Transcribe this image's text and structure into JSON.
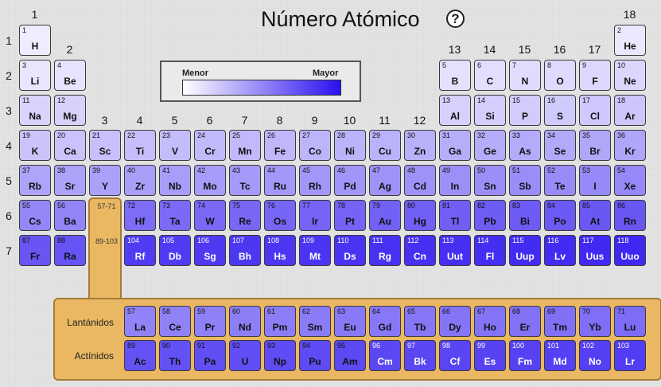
{
  "title": "Número Atómico",
  "help_label": "?",
  "legend": {
    "low_label": "Menor",
    "high_label": "Mayor",
    "colors": [
      "#ffffff",
      "#2a10f0"
    ]
  },
  "groups": [
    "1",
    "2",
    "3",
    "4",
    "5",
    "6",
    "7",
    "8",
    "9",
    "10",
    "11",
    "12",
    "13",
    "14",
    "15",
    "16",
    "17",
    "18"
  ],
  "periods": [
    "1",
    "2",
    "3",
    "4",
    "5",
    "6",
    "7"
  ],
  "lanthanide_range": "57-71",
  "actinide_range": "89-103",
  "lanthanides_label": "Lantánidos",
  "actinides_label": "Actínidos",
  "periodic_rows": [
    [
      "1:H",
      "",
      "",
      "",
      "",
      "",
      "",
      "",
      "",
      "",
      "",
      "",
      "",
      "",
      "",
      "",
      "",
      "2:He"
    ],
    [
      "3:Li",
      "4:Be",
      "",
      "",
      "",
      "",
      "",
      "",
      "",
      "",
      "",
      "",
      "5:B",
      "6:C",
      "7:N",
      "8:O",
      "9:F",
      "10:Ne"
    ],
    [
      "11:Na",
      "12:Mg",
      "",
      "",
      "",
      "",
      "",
      "",
      "",
      "",
      "",
      "",
      "13:Al",
      "14:Si",
      "15:P",
      "16:S",
      "17:Cl",
      "18:Ar"
    ],
    [
      "19:K",
      "20:Ca",
      "21:Sc",
      "22:Ti",
      "23:V",
      "24:Cr",
      "25:Mn",
      "26:Fe",
      "27:Co",
      "28:Ni",
      "29:Cu",
      "30:Zn",
      "31:Ga",
      "32:Ge",
      "33:As",
      "34:Se",
      "35:Br",
      "36:Kr"
    ],
    [
      "37:Rb",
      "38:Sr",
      "39:Y",
      "40:Zr",
      "41:Nb",
      "42:Mo",
      "43:Tc",
      "44:Ru",
      "45:Rh",
      "46:Pd",
      "47:Ag",
      "48:Cd",
      "49:In",
      "50:Sn",
      "51:Sb",
      "52:Te",
      "53:I",
      "54:Xe"
    ],
    [
      "55:Cs",
      "56:Ba",
      "",
      "72:Hf",
      "73:Ta",
      "74:W",
      "75:Re",
      "76:Os",
      "77:Ir",
      "78:Pt",
      "79:Au",
      "80:Hg",
      "81:Tl",
      "82:Pb",
      "83:Bi",
      "84:Po",
      "85:At",
      "86:Rn"
    ],
    [
      "87:Fr",
      "88:Ra",
      "",
      "104:Rf",
      "105:Db",
      "106:Sg",
      "107:Bh",
      "108:Hs",
      "109:Mt",
      "110:Ds",
      "111:Rg",
      "112:Cn",
      "113:Uut",
      "114:Fl",
      "115:Uup",
      "116:Lv",
      "117:Uus",
      "118:Uuo"
    ]
  ],
  "lanthanides": [
    "57:La",
    "58:Ce",
    "59:Pr",
    "60:Nd",
    "61:Pm",
    "62:Sm",
    "63:Eu",
    "64:Gd",
    "65:Tb",
    "66:Dy",
    "67:Ho",
    "68:Er",
    "69:Tm",
    "70:Yb",
    "71:Lu"
  ],
  "actinides": [
    "89:Ac",
    "90:Th",
    "91:Pa",
    "92:U",
    "93:Np",
    "94:Pu",
    "95:Am",
    "96:Cm",
    "97:Bk",
    "98:Cf",
    "99:Es",
    "100:Fm",
    "101:Md",
    "102:No",
    "103:Lr"
  ]
}
